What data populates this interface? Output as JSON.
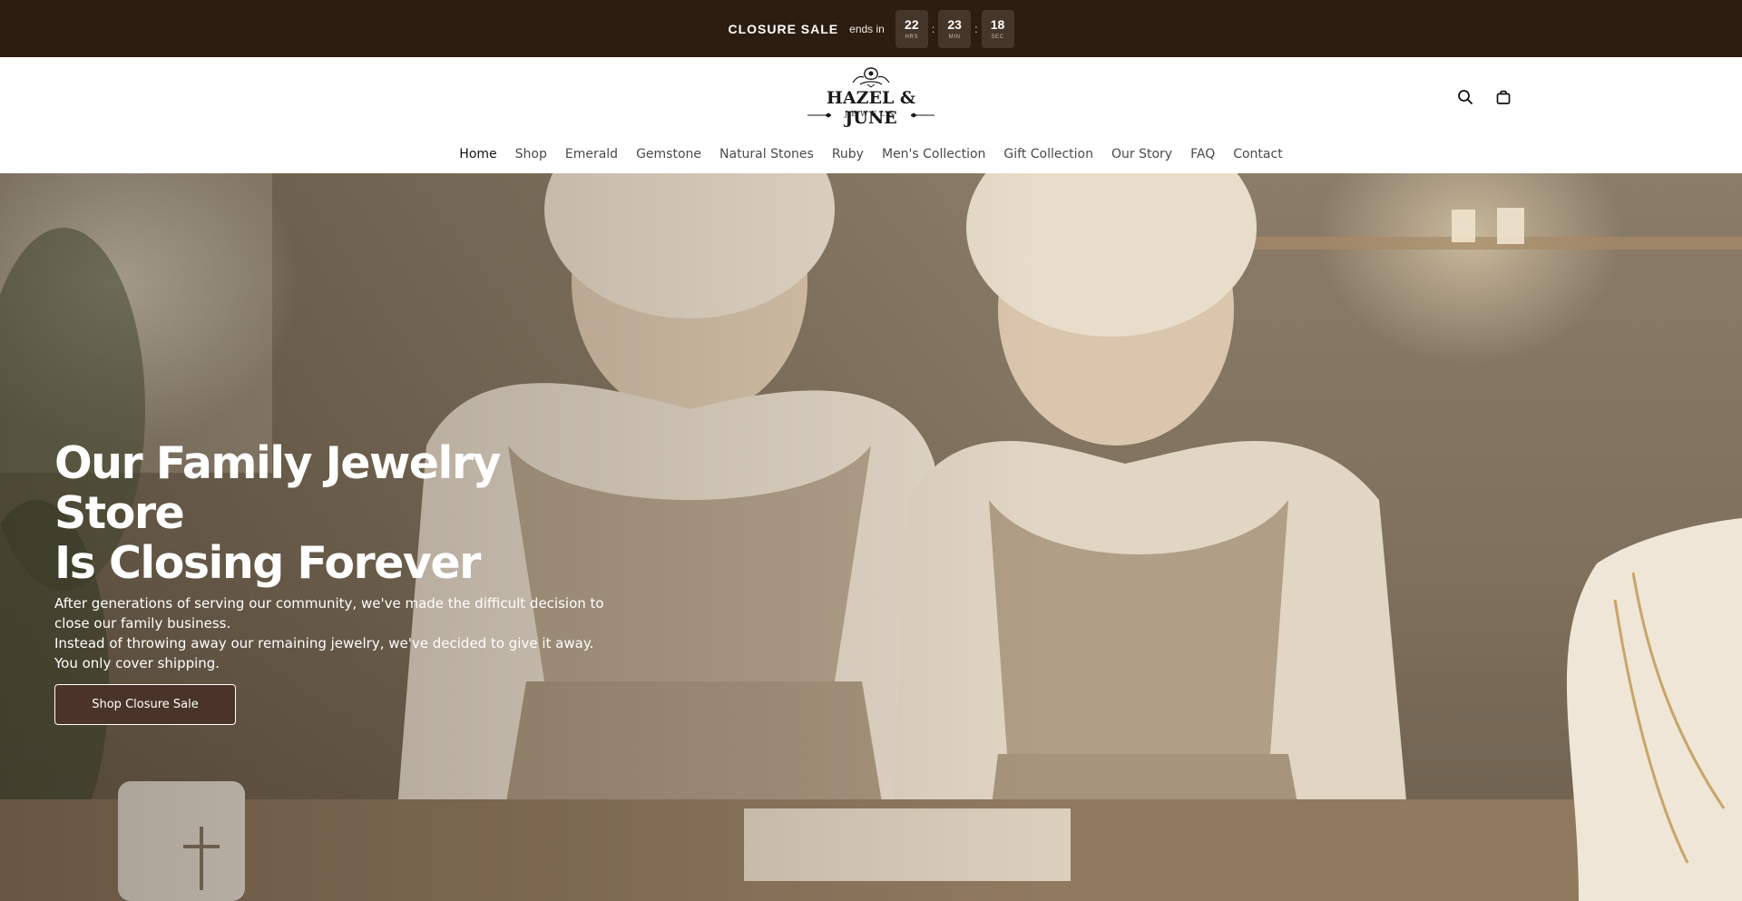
{
  "announcement": {
    "sale_label": "CLOSURE SALE",
    "ends_in": "ends in",
    "countdown": [
      {
        "value": "22",
        "unit": "HRS"
      },
      {
        "value": "23",
        "unit": "MIN"
      },
      {
        "value": "18",
        "unit": "SEC"
      }
    ],
    "separator": ":"
  },
  "header": {
    "logo": {
      "name": "HAZEL & JUNE",
      "subtitle": "JEWELS"
    },
    "icons": [
      "search-icon",
      "shopping-bag-icon"
    ]
  },
  "nav": {
    "items": [
      {
        "label": "Home",
        "active": true
      },
      {
        "label": "Shop",
        "active": false
      },
      {
        "label": "Emerald",
        "active": false
      },
      {
        "label": "Gemstone",
        "active": false
      },
      {
        "label": "Natural Stones",
        "active": false
      },
      {
        "label": "Ruby",
        "active": false
      },
      {
        "label": "Men's Collection",
        "active": false
      },
      {
        "label": "Gift Collection",
        "active": false
      },
      {
        "label": "Our Story",
        "active": false
      },
      {
        "label": "FAQ",
        "active": false
      },
      {
        "label": "Contact",
        "active": false
      }
    ]
  },
  "hero": {
    "title_line1": "Our Family Jewelry Store",
    "title_line2": "Is Closing Forever",
    "description": [
      "After generations of serving our community, we've made the difficult decision to",
      "close our family business.",
      "Instead of throwing away our remaining jewelry, we've decided to give it away.",
      "You only cover shipping."
    ],
    "cta_label": "Shop Closure Sale"
  },
  "colors": {
    "topbar_bg": "#2c1d10",
    "countdown_box": "#46362a",
    "cta_bg": "#4a3328",
    "text_dark": "#111111"
  }
}
